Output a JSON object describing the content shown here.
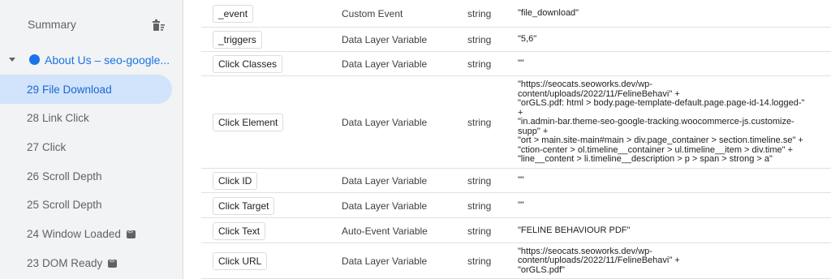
{
  "sidebar": {
    "summary_label": "Summary",
    "page_label": "About Us – seo-google...",
    "events": [
      {
        "num": "29",
        "label": "File Download",
        "active": true,
        "badge": false
      },
      {
        "num": "28",
        "label": "Link Click",
        "active": false,
        "badge": false
      },
      {
        "num": "27",
        "label": "Click",
        "active": false,
        "badge": false
      },
      {
        "num": "26",
        "label": "Scroll Depth",
        "active": false,
        "badge": false
      },
      {
        "num": "25",
        "label": "Scroll Depth",
        "active": false,
        "badge": false
      },
      {
        "num": "24",
        "label": "Window Loaded",
        "active": false,
        "badge": true
      },
      {
        "num": "23",
        "label": "DOM Ready",
        "active": false,
        "badge": true
      }
    ]
  },
  "table": {
    "rows": [
      {
        "name": "_event",
        "type": "Custom Event",
        "return": "string",
        "value": [
          "\"file_download\""
        ]
      },
      {
        "name": "_triggers",
        "type": "Data Layer Variable",
        "return": "string",
        "value": [
          "\"5,6\""
        ]
      },
      {
        "name": "Click Classes",
        "type": "Data Layer Variable",
        "return": "string",
        "value": [
          "\"\""
        ]
      },
      {
        "name": "Click Element",
        "type": "Data Layer Variable",
        "return": "string",
        "value": [
          "\"https://seocats.seoworks.dev/wp-",
          "content/uploads/2022/11/FelineBehavi\" +",
          "\"orGLS.pdf: html > body.page-template-default.page.page-id-14.logged-\"",
          "+",
          "\"in.admin-bar.theme-seo-google-tracking.woocommerce-js.customize-",
          "supp\" +",
          "\"ort > main.site-main#main > div.page_container > section.timeline.se\" +",
          "\"ction-center > ol.timeline__container > ul.timeline__item > div.time\" +",
          "\"line__content > li.timeline__description > p > span > strong > a\""
        ]
      },
      {
        "name": "Click ID",
        "type": "Data Layer Variable",
        "return": "string",
        "value": [
          "\"\""
        ]
      },
      {
        "name": "Click Target",
        "type": "Data Layer Variable",
        "return": "string",
        "value": [
          "\"\""
        ]
      },
      {
        "name": "Click Text",
        "type": "Auto-Event Variable",
        "return": "string",
        "value": [
          "\"FELINE BEHAVIOUR PDF\""
        ]
      },
      {
        "name": "Click URL",
        "type": "Data Layer Variable",
        "return": "string",
        "value": [
          "\"https://seocats.seoworks.dev/wp-",
          "content/uploads/2022/11/FelineBehavi\" +",
          "\"orGLS.pdf\""
        ]
      }
    ]
  },
  "icons": {
    "trash": "delete-sweep-icon",
    "caret": "caret-down-icon",
    "dot": "page-dot-icon",
    "badge": "code-badge-icon"
  },
  "colors": {
    "accent": "#1a73e8",
    "active_bg": "#d2e3fc",
    "sidebar_bg": "#f1f3f4"
  }
}
